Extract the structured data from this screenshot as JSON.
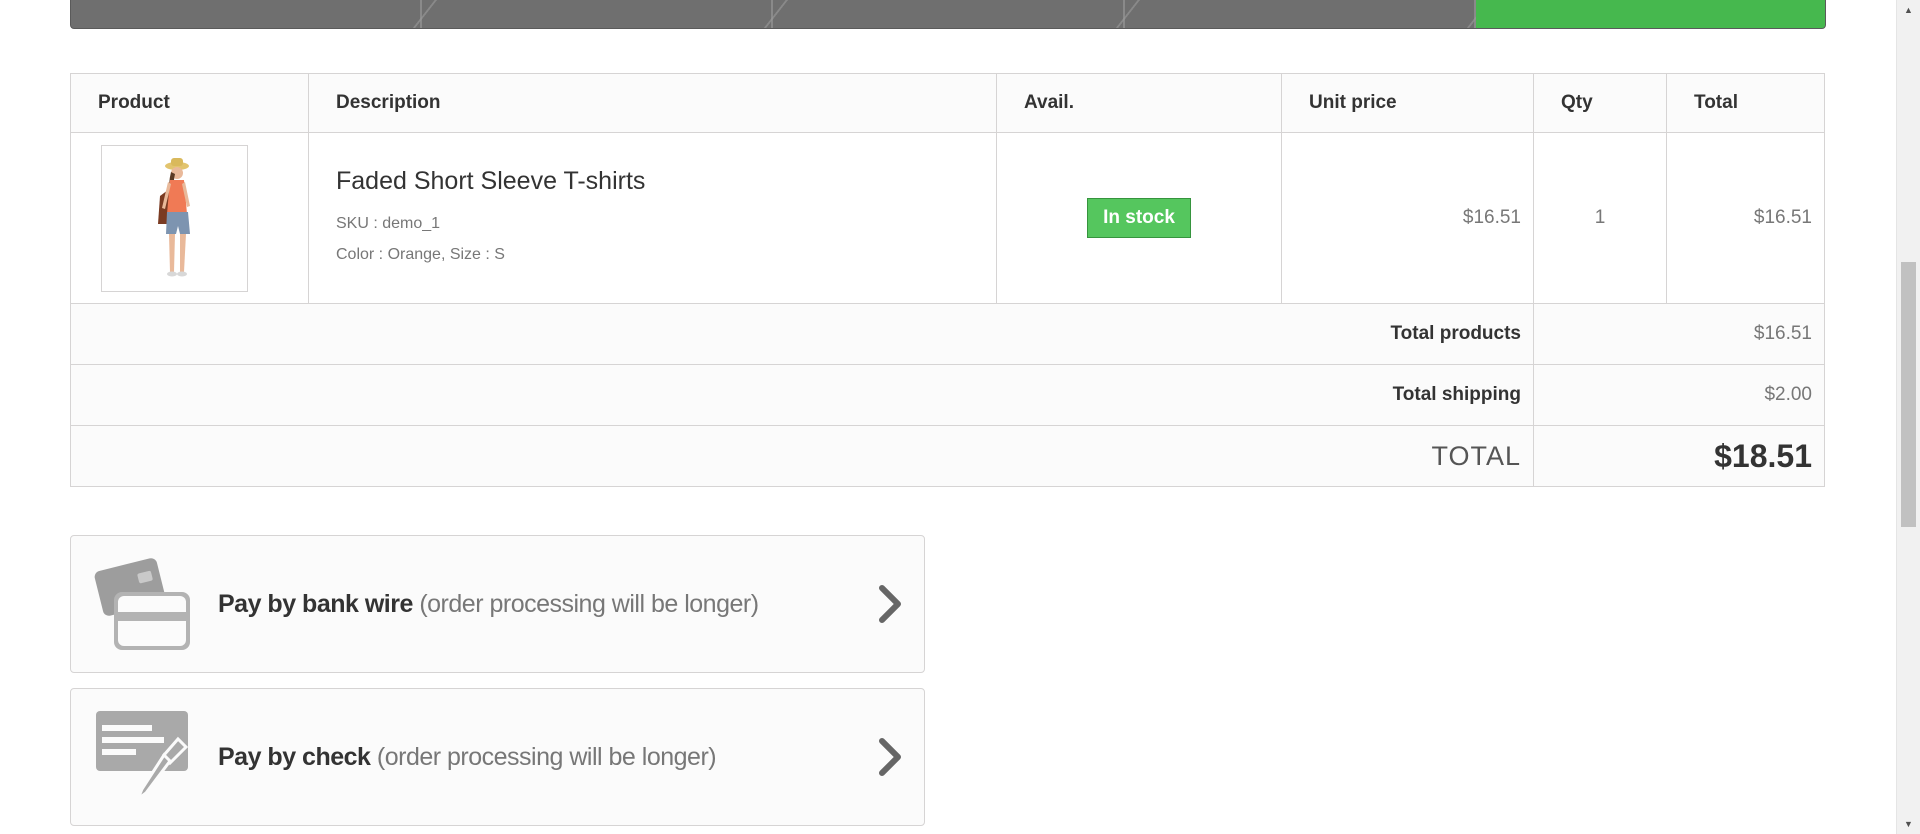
{
  "cart": {
    "headers": {
      "product": "Product",
      "description": "Description",
      "avail": "Avail.",
      "unit_price": "Unit price",
      "qty": "Qty",
      "total": "Total"
    },
    "item": {
      "name": "Faded Short Sleeve T-shirts",
      "sku": "SKU : demo_1",
      "attributes": "Color : Orange, Size : S",
      "availability": "In stock",
      "unit_price": "$16.51",
      "qty": "1",
      "total": "$16.51"
    },
    "totals": {
      "products_label": "Total products",
      "products_value": "$16.51",
      "shipping_label": "Total shipping",
      "shipping_value": "$2.00",
      "grand_label": "TOTAL",
      "grand_value": "$18.51"
    }
  },
  "payment": {
    "bankwire": {
      "title": "Pay by bank wire",
      "note": "(order processing will be longer)"
    },
    "check": {
      "title": "Pay by check",
      "note": "(order processing will be longer)"
    }
  },
  "colors": {
    "current_step": "#46b84e",
    "instock_badge": "#55c65e",
    "step_bar": "#6f6f6f"
  }
}
